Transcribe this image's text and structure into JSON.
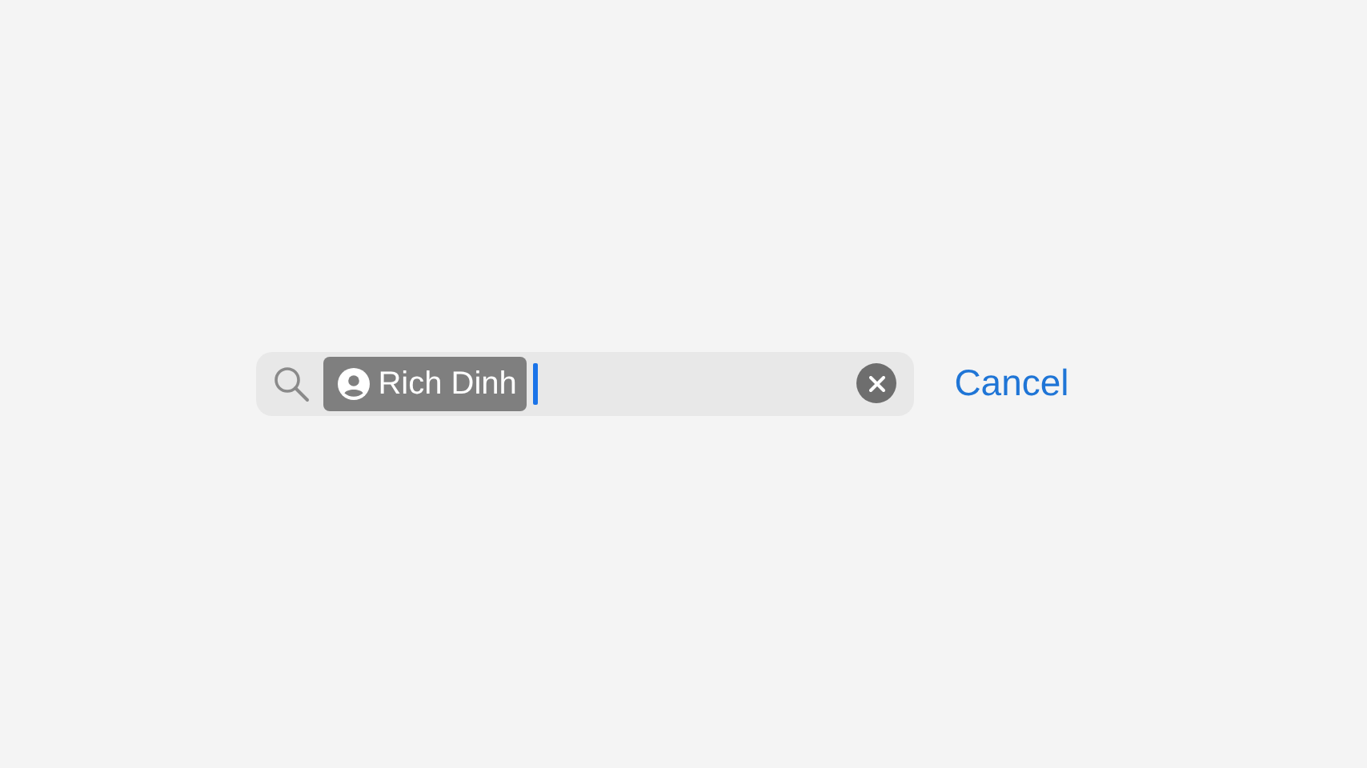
{
  "search": {
    "tokens": [
      {
        "label": "Rich Dinh",
        "kind": "person"
      }
    ]
  },
  "buttons": [
    {
      "label": "Cancel"
    }
  ]
}
